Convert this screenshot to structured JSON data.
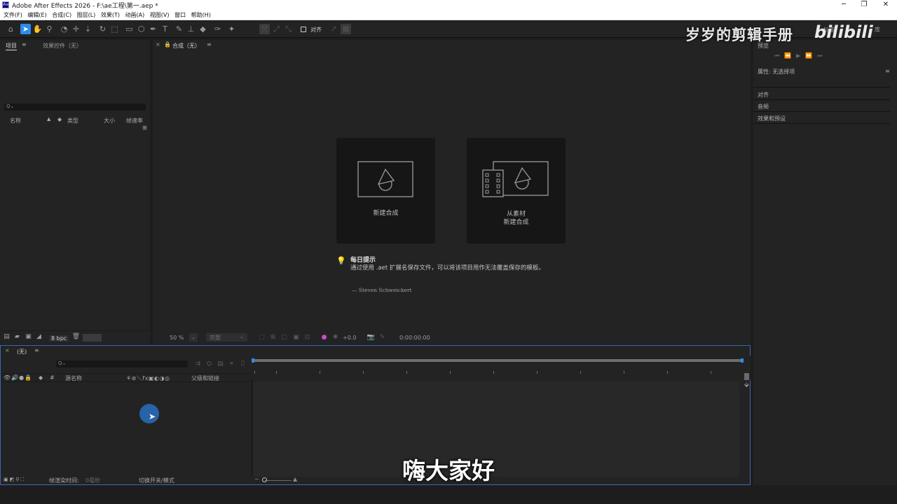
{
  "window": {
    "logo": "Ae",
    "title": "Adobe After Effects 2026 - F:\\ae工程\\第一.aep *",
    "minimize_icon": "─",
    "restore_icon": "❐",
    "close_icon": "✕"
  },
  "menu": [
    "文件(F)",
    "编辑(E)",
    "合成(C)",
    "图层(L)",
    "效果(T)",
    "动画(A)",
    "视图(V)",
    "窗口",
    "帮助(H)"
  ],
  "toolbar": {
    "align_label": "对齐",
    "right_labels": [
      "标准",
      "库"
    ]
  },
  "project_panel": {
    "tab_project": "项目",
    "tab_effects": "效果控件（无）",
    "search_icon": "Q⌄",
    "columns": [
      "名称",
      "类型",
      "大小",
      "帧速率"
    ],
    "bpc": "8 bpc"
  },
  "comp_panel": {
    "tab_label": "合成（无）",
    "card_new": "新建合成",
    "card_from_footage_line1": "从素材",
    "card_from_footage_line2": "新建合成",
    "tip_title": "每日提示",
    "tip_text": "通过使用 .aet 扩展名保存文件，可以将该项目用作无法覆盖保存的模板。",
    "tip_author": "— Steven Schweickert",
    "zoom": "50 %",
    "quality": "完整",
    "exposure": "+0.0",
    "timecode": "0:00:00:00"
  },
  "timeline": {
    "tab_label": "(无)",
    "search_icon": "Q⌄",
    "col_hash": "#",
    "col_source": "源名称",
    "col_parent": "父级和链接",
    "render_time_label": "帧渲染时间:",
    "render_time_value": "0毫秒",
    "toggle_label": "切换开关/模式"
  },
  "right_panel": {
    "preview": "预览",
    "properties": "属性: 无选择项",
    "align": "对齐",
    "audio": "音频",
    "effects_presets": "效果和预设"
  },
  "overlay": {
    "watermark": "岁岁的剪辑手册",
    "bili": "bilibili",
    "subtitle": "嗨大家好"
  }
}
